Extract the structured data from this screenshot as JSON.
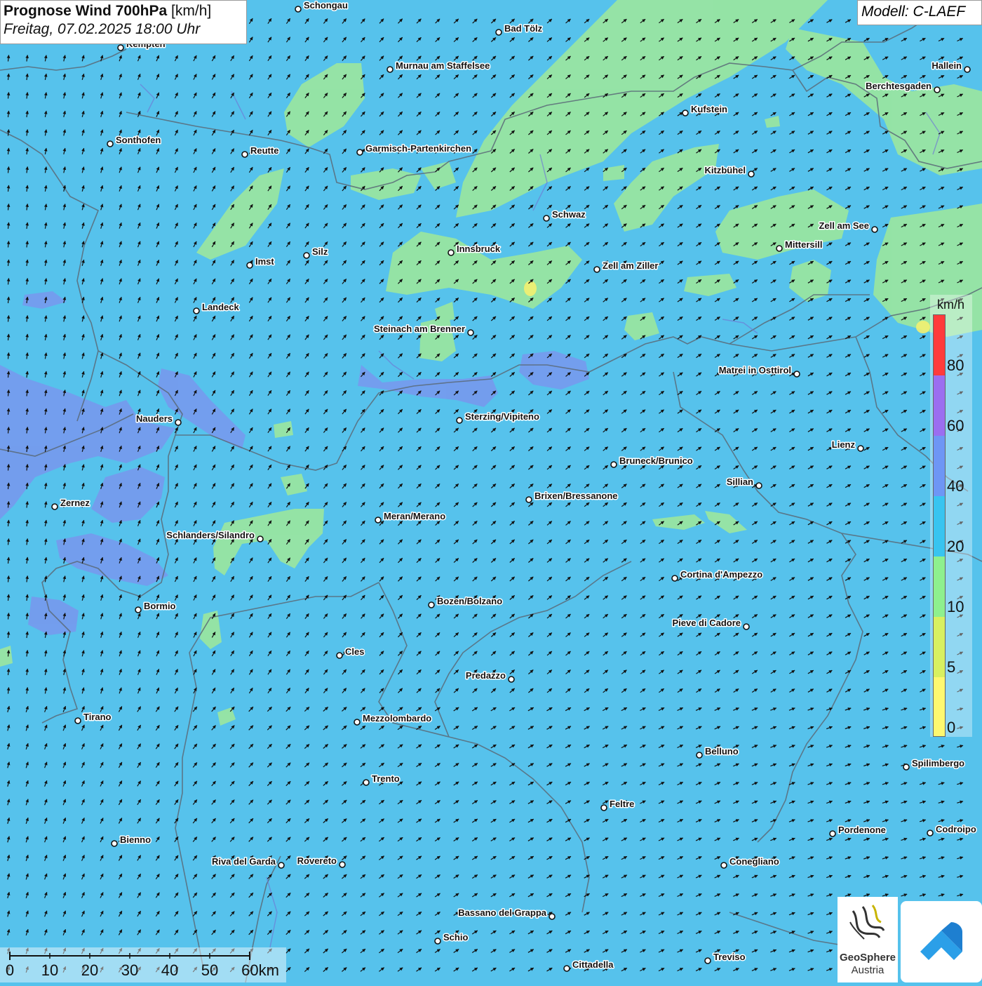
{
  "title": {
    "main": "Prognose Wind 700hPa",
    "unit": "[km/h]",
    "datetime": "Freitag, 07.02.2025 18:00 Uhr"
  },
  "model": "Modell: C-LAEF",
  "legend": {
    "unit": "km/h",
    "labels": [
      "80",
      "60",
      "40",
      "20",
      "10",
      "5",
      "0"
    ],
    "colors": [
      "#ff3b3b",
      "#9b6ef0",
      "#6e96f5",
      "#38c4f0",
      "#8ef08e",
      "#d8f060",
      "#fff870"
    ]
  },
  "scale": {
    "labels": [
      "0",
      "10",
      "20",
      "30",
      "40",
      "50",
      "60km"
    ]
  },
  "logo": {
    "line1": "GeoSphere",
    "line2": "Austria"
  },
  "cities": [
    {
      "name": "Schongau"
    },
    {
      "name": "Kempten"
    },
    {
      "name": "Bad Tölz"
    },
    {
      "name": "Murnau am Staffelsee"
    },
    {
      "name": "Hallein"
    },
    {
      "name": "Berchtesgaden"
    },
    {
      "name": "Kufstein"
    },
    {
      "name": "Sonthofen"
    },
    {
      "name": "Reutte"
    },
    {
      "name": "Garmisch-Partenkirchen"
    },
    {
      "name": "Kitzbühel"
    },
    {
      "name": "Schwaz"
    },
    {
      "name": "Zell am See"
    },
    {
      "name": "Mittersill"
    },
    {
      "name": "Innsbruck"
    },
    {
      "name": "Imst"
    },
    {
      "name": "Silz"
    },
    {
      "name": "Zell am Ziller"
    },
    {
      "name": "Landeck"
    },
    {
      "name": "Steinach am Brenner"
    },
    {
      "name": "Matrei in Osttirol"
    },
    {
      "name": "Nauders"
    },
    {
      "name": "Sterzing/Vipiteno"
    },
    {
      "name": "Lienz"
    },
    {
      "name": "Bruneck/Brunico"
    },
    {
      "name": "Sillian"
    },
    {
      "name": "Zernez"
    },
    {
      "name": "Brixen/Bressanone"
    },
    {
      "name": "Meran/Merano"
    },
    {
      "name": "Schlanders/Silandro"
    },
    {
      "name": "Cortina d'Ampezzo"
    },
    {
      "name": "Bormio"
    },
    {
      "name": "Bozen/Bolzano"
    },
    {
      "name": "Pieve di Cadore"
    },
    {
      "name": "Cles"
    },
    {
      "name": "Predazzo"
    },
    {
      "name": "Tirano"
    },
    {
      "name": "Mezzolombardo"
    },
    {
      "name": "Belluno"
    },
    {
      "name": "Spilimbergo"
    },
    {
      "name": "Trento"
    },
    {
      "name": "Feltre"
    },
    {
      "name": "Pordenone"
    },
    {
      "name": "Codroipo"
    },
    {
      "name": "Bienno"
    },
    {
      "name": "Riva del Garda"
    },
    {
      "name": "Rovereto"
    },
    {
      "name": "Conegliano"
    },
    {
      "name": "Bassano del Grappa"
    },
    {
      "name": "Schio"
    },
    {
      "name": "Treviso"
    },
    {
      "name": "Cittadella"
    }
  ]
}
